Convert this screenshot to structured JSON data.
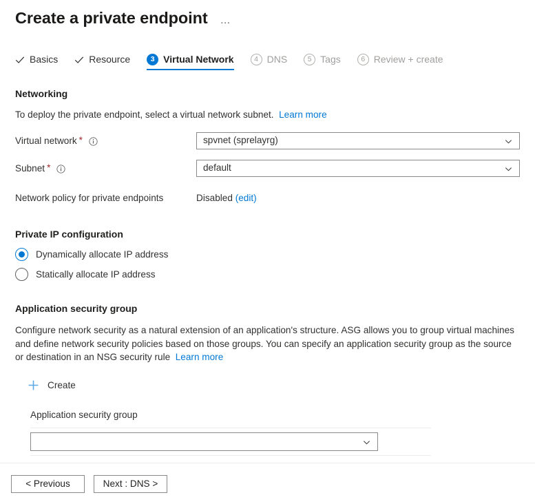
{
  "header": {
    "title": "Create a private endpoint",
    "more_label": "…"
  },
  "wizard_tabs": [
    {
      "label": "Basics",
      "state": "done",
      "icon": "check-icon",
      "number": ""
    },
    {
      "label": "Resource",
      "state": "done",
      "icon": "check-icon",
      "number": ""
    },
    {
      "label": "Virtual Network",
      "state": "active",
      "icon": "number-badge",
      "number": "3"
    },
    {
      "label": "DNS",
      "state": "upcoming",
      "icon": "number-badge",
      "number": "4"
    },
    {
      "label": "Tags",
      "state": "upcoming",
      "icon": "number-badge",
      "number": "5"
    },
    {
      "label": "Review + create",
      "state": "upcoming",
      "icon": "number-badge",
      "number": "6"
    }
  ],
  "networking": {
    "heading": "Networking",
    "intro_text": "To deploy the private endpoint, select a virtual network subnet.",
    "intro_link": "Learn more",
    "virtual_network": {
      "label": "Virtual network",
      "required_marker": "*",
      "info_icon": "info-icon",
      "value": "spvnet (sprelayrg)"
    },
    "subnet": {
      "label": "Subnet",
      "required_marker": "*",
      "info_icon": "info-icon",
      "value": "default"
    },
    "network_policy": {
      "label": "Network policy for private endpoints",
      "value": "Disabled",
      "edit_link": "(edit)"
    }
  },
  "private_ip": {
    "heading": "Private IP configuration",
    "options": [
      {
        "label": "Dynamically allocate IP address",
        "selected": true
      },
      {
        "label": "Statically allocate IP address",
        "selected": false
      }
    ]
  },
  "asg": {
    "heading": "Application security group",
    "description": "Configure network security as a natural extension of an application's structure. ASG allows you to group virtual machines and define network security policies based on those groups. You can specify an application security group as the source or destination in an NSG security rule",
    "description_link": "Learn more",
    "create_label": "Create",
    "create_icon": "plus-icon",
    "field_label": "Application security group",
    "field_value": "",
    "field_placeholder": ""
  },
  "footer": {
    "previous_label": "< Previous",
    "next_label": "Next : DNS >"
  },
  "colors": {
    "accent": "#0078d4",
    "link": "#0078d4",
    "required": "#a4262c",
    "text": "#323130",
    "muted": "#a19f9d",
    "border": "#8a8886",
    "divider": "#edebe9"
  }
}
